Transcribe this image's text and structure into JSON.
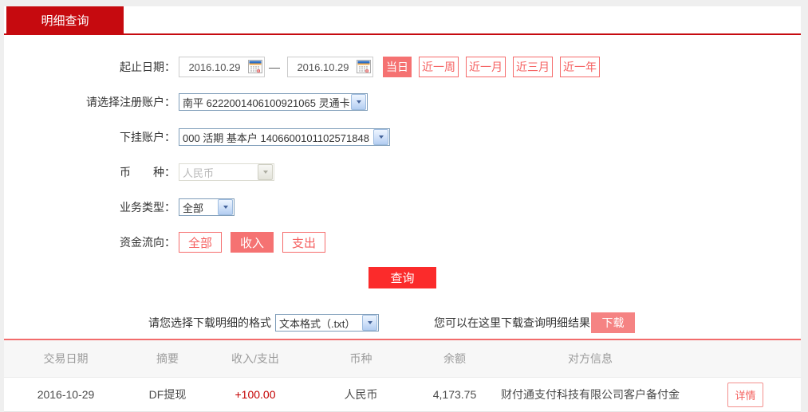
{
  "tab": {
    "label": "明细查询"
  },
  "form": {
    "date": {
      "label": "起止日期：",
      "start": "2016.10.29",
      "end": "2016.10.29",
      "separator": "—",
      "quick": [
        "当日",
        "近一周",
        "近一月",
        "近三月",
        "近一年"
      ],
      "quick_selected": "当日"
    },
    "register_account": {
      "label": "请选择注册账户：",
      "value": "南平 6222001406100921065 灵通卡"
    },
    "sub_account": {
      "label": "下挂账户：",
      "value": "000 活期 基本户 1406600101102571848"
    },
    "currency": {
      "label": "币　　种：",
      "value": "人民币",
      "disabled": true
    },
    "business_type": {
      "label": "业务类型：",
      "value": "全部"
    },
    "fund_flow": {
      "label": "资金流向：",
      "options": [
        "全部",
        "收入",
        "支出"
      ],
      "selected": "收入"
    },
    "query_button": "查询"
  },
  "download": {
    "format_label": "请您选择下载明细的格式",
    "format_value": "文本格式（.txt）",
    "result_hint": "您可以在这里下载查询明细结果",
    "button": "下载"
  },
  "table": {
    "headers": [
      "交易日期",
      "摘要",
      "收入/支出",
      "币种",
      "余额",
      "对方信息"
    ],
    "rows": [
      {
        "date": "2016-10-29",
        "summary": "DF提现",
        "amount": "+100.00",
        "currency": "人民币",
        "balance": "4,173.75",
        "counterparty": "财付通支付科技有限公司客户备付金",
        "action": "详情"
      }
    ]
  },
  "colors": {
    "brand_red": "#c60a0f",
    "query_red": "#fb2b2b",
    "pink_accent": "#f57272",
    "download_pink": "#f58383",
    "amount_red": "#c40000",
    "table_top_line": "#f26c6c"
  }
}
